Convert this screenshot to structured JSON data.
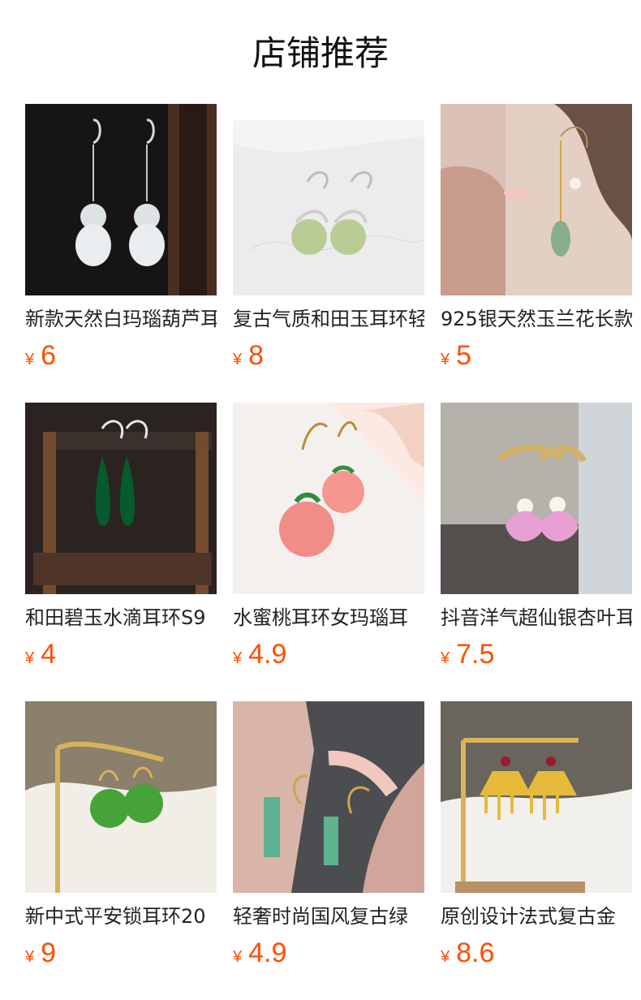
{
  "header": {
    "title": "店铺推荐"
  },
  "currency_symbol": "¥",
  "products": [
    {
      "name": "新款天然白玛瑙葫芦耳",
      "price": "6"
    },
    {
      "name": "复古气质和田玉耳环轻",
      "price": "8"
    },
    {
      "name": "925银天然玉兰花长款",
      "price": "5"
    },
    {
      "name": "和田碧玉水滴耳环S9",
      "price": "4"
    },
    {
      "name": "水蜜桃耳环女玛瑙耳",
      "price": "4.9"
    },
    {
      "name": "抖音洋气超仙银杏叶耳",
      "price": "7.5"
    },
    {
      "name": "新中式平安锁耳环20",
      "price": "9"
    },
    {
      "name": "轻奢时尚国风复古绿",
      "price": "4.9"
    },
    {
      "name": "原创设计法式复古金",
      "price": "8.6"
    }
  ],
  "colors": {
    "price": "#ff4f00",
    "text": "#222222",
    "title": "#111111"
  }
}
